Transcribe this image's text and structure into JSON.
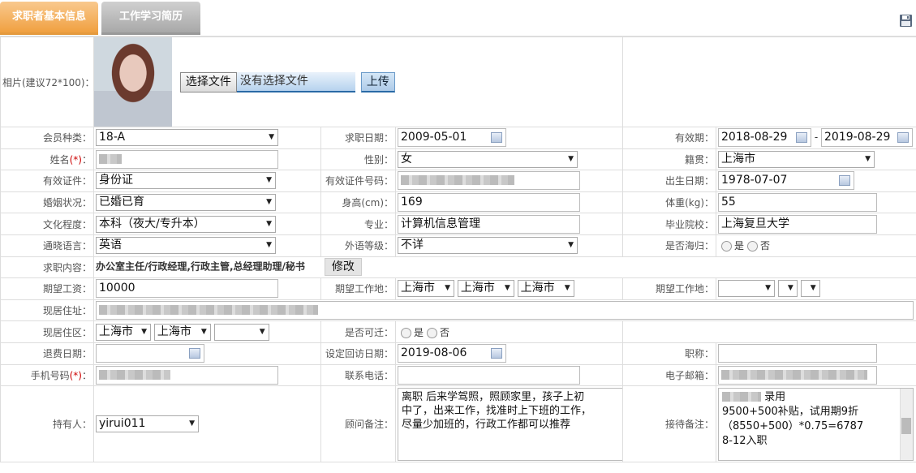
{
  "tabs": {
    "basic": "求职者基本信息",
    "history": "工作学习简历"
  },
  "photo": {
    "label": "相片(建议72*100)：",
    "choose_button": "选择文件",
    "no_file": "没有选择文件",
    "upload_button": "上传"
  },
  "fields": {
    "member_type": {
      "label": "会员种类：",
      "value": "18-A"
    },
    "apply_date": {
      "label": "求职日期：",
      "value": "2009-05-01"
    },
    "valid_period": {
      "label": "有效期：",
      "start": "2018-08-29",
      "sep": "-",
      "end": "2019-08-29"
    },
    "name": {
      "label": "姓名",
      "req": "(*)",
      "colon": "："
    },
    "gender": {
      "label": "性别：",
      "value": "女"
    },
    "native": {
      "label": "籍贯：",
      "value": "上海市"
    },
    "id_type": {
      "label": "有效证件：",
      "value": "身份证"
    },
    "id_number": {
      "label": "有效证件号码："
    },
    "birth": {
      "label": "出生日期：",
      "value": "1978-07-07"
    },
    "marital": {
      "label": "婚姻状况：",
      "value": "已婚已育"
    },
    "height": {
      "label": "身高(cm)：",
      "value": "169"
    },
    "weight": {
      "label": "体重(kg)：",
      "value": "55"
    },
    "education": {
      "label": "文化程度：",
      "value": "本科（夜大/专升本）"
    },
    "major": {
      "label": "专业：",
      "value": "计算机信息管理"
    },
    "school": {
      "label": "毕业院校：",
      "value": "上海复旦大学"
    },
    "language": {
      "label": "通晓语言：",
      "value": "英语"
    },
    "lang_level": {
      "label": "外语等级：",
      "value": "不详"
    },
    "returnee": {
      "label": "是否海归：",
      "yes": "是",
      "no": "否"
    },
    "job_content": {
      "label": "求职内容：",
      "value": "办公室主任/行政经理,行政主管,总经理助理/秘书",
      "modify": "修改"
    },
    "salary": {
      "label": "期望工资：",
      "value": "10000"
    },
    "work_place": {
      "label": "期望工作地：",
      "v1": "上海市",
      "v2": "上海市",
      "v3": "上海市"
    },
    "work_place2": {
      "label": "期望工作地："
    },
    "address": {
      "label": "现居住址："
    },
    "district": {
      "label": "现居住区：",
      "v1": "上海市",
      "v2": "上海市"
    },
    "relocate": {
      "label": "是否可迁：",
      "yes": "是",
      "no": "否"
    },
    "retire_date": {
      "label": "退费日期："
    },
    "revisit_date": {
      "label": "设定回访日期：",
      "value": "2019-08-06"
    },
    "title": {
      "label": "职称："
    },
    "mobile": {
      "label": "手机号码",
      "req": "(*)",
      "colon": "："
    },
    "phone": {
      "label": "联系电话："
    },
    "email": {
      "label": "电子邮箱："
    },
    "holder": {
      "label": "持有人：",
      "value": "yirui011"
    },
    "consultant_note": {
      "label": "顾问备注：",
      "lines": [
        "离职 后来学驾照，照顾家里，孩子上初",
        "中了，出来工作，找准时上下班的工作，",
        "尽量少加班的，行政工作都可以推荐"
      ]
    },
    "reception_note": {
      "label": "接待备注：",
      "lines": [
        "录用",
        "9500+500补贴，试用期9折",
        "（8550+500）*0.75=6787",
        "8-12入职"
      ]
    }
  }
}
